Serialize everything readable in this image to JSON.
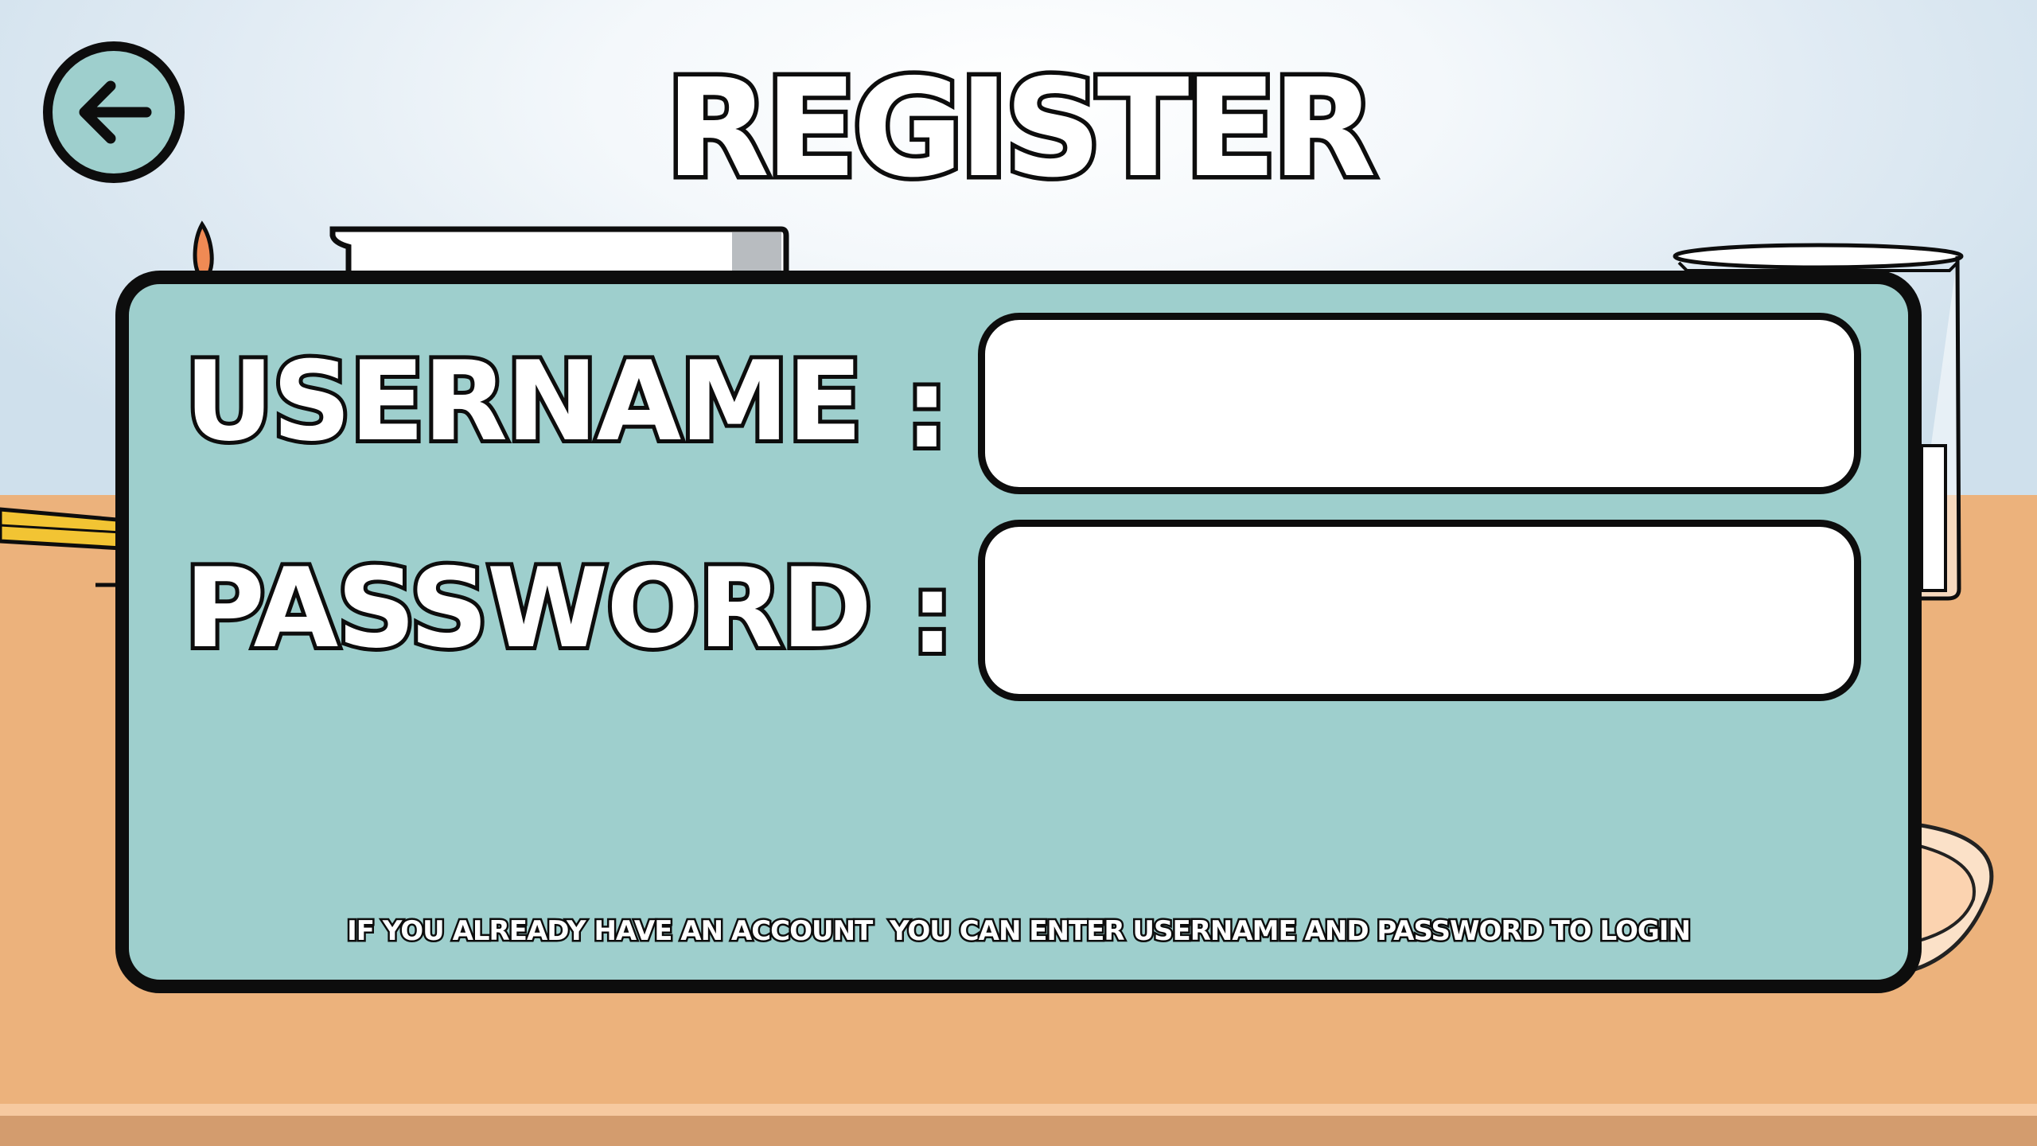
{
  "screen": {
    "title": "REGISTER"
  },
  "back_button": {
    "icon": "arrow-left-icon"
  },
  "form": {
    "username_label": "USERNAME",
    "password_label": "PASSWORD",
    "colon": ":",
    "username_value": "",
    "password_value": ""
  },
  "hint": "IF YOU ALREADY HAVE AN ACCOUNT  YOU CAN ENTER USERNAME AND PASSWORD TO LOGIN",
  "colors": {
    "panel": "#9ecfcd",
    "outline": "#0d0d0d",
    "table": "#ecb27c",
    "sky": "#dfeaf3"
  }
}
